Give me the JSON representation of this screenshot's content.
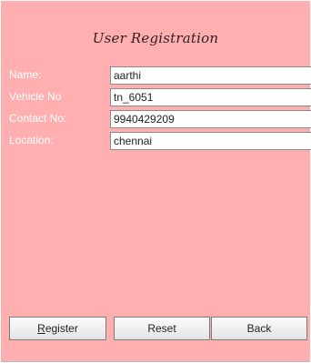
{
  "form": {
    "title": "User Registration",
    "fields": [
      {
        "label": "Name:",
        "value": "aarthi"
      },
      {
        "label": "Vehicle No",
        "value": "tn_6051"
      },
      {
        "label": "Contact No:",
        "value": "9940429209"
      },
      {
        "label": "Location:",
        "value": "chennai"
      }
    ]
  },
  "buttons": {
    "register_mnemonic": "R",
    "register_rest": "egister",
    "reset_label": "Reset",
    "back_label": "Back"
  }
}
